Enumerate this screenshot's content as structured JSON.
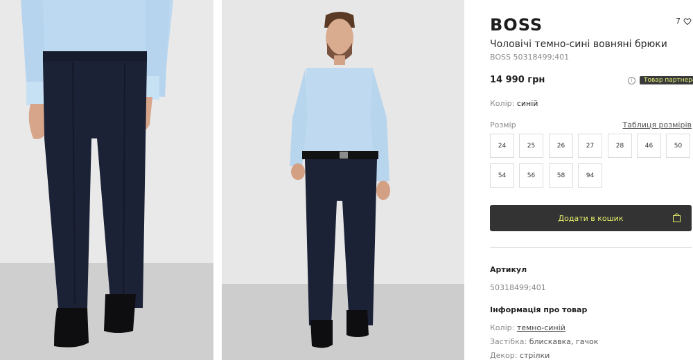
{
  "product": {
    "brand": "BOSS",
    "favorites_count": "7",
    "title": "Чоловічі темно-сині вовняні брюки",
    "sku_line": "BOSS 50318499;401",
    "price": "14 990 грн",
    "partner_badge": "Товар партнера",
    "color_label": "Колір:",
    "color_value": "синій",
    "size_label": "Розмір",
    "size_chart_link": "Таблиця розмірів",
    "sizes": [
      "24",
      "25",
      "26",
      "27",
      "28",
      "46",
      "50",
      "54",
      "56",
      "58",
      "94"
    ],
    "add_to_cart": "Додати в кошик",
    "article_heading": "Артикул",
    "article_value": "50318499;401",
    "info_heading": "Інформація про товар",
    "attributes": [
      {
        "label": "Колір:",
        "value": "темно-синій"
      },
      {
        "label": "Застібка:",
        "value": "блискавка, гачок"
      },
      {
        "label": "Декор:",
        "value": "стрілки"
      }
    ]
  },
  "colors": {
    "accent": "#e7f06d",
    "button_bg": "#333333",
    "pants": "#1c2236",
    "shirt": "#bfdaf0"
  },
  "icons": [
    "heart-icon",
    "info-icon",
    "shopping-bag-icon"
  ]
}
